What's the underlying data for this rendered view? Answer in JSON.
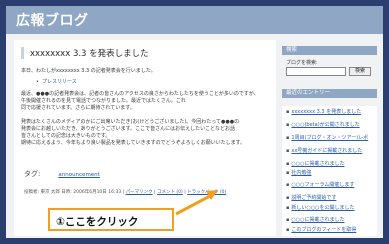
{
  "header": {
    "title": "広報ブログ"
  },
  "post": {
    "title": "xxxxxxxx 3.3 を発表しました",
    "intro": "本日、わたしがxxxxxxxx 3.3 の記者発表会を行いました。",
    "link": "プレスリリース",
    "body": [
      "最近、●●●の記者発表会は、記者の皆さんのアクセスの良さからわたしたちを使うことが多いのですが、",
      "午後開催されるのを見て電話でつながりました。最近ではたくさん。これ",
      "同で応援されています。さらに期待されています。",
      "発表はたくさんのメディアのかにご出席いただき(お(けどうございました)。今回わたって●●●の",
      "発表会にお越しいただき、ありがとうございます。ここで皆さんにはお伝えしたいことなどお話",
      "皆さんとしての記念は大きいものです。",
      "期待に応えるよう、今年もより良い製品を発表していきますのでどうぞよろしくお願いいたします。"
    ],
    "tag_label": "タグ:",
    "tag_value": "announcement",
    "footer_meta": "投稿者: 東京 太郎 日時: 2006年6月10日 16:33 |",
    "permalink": "パーマリンク",
    "comment_link": "コメント (0)",
    "trackback_link": "トラックバック (0)"
  },
  "callout": {
    "text": "①ここをクリック"
  },
  "sidebar": {
    "search_heading": "検索",
    "search_label": "ブログを検索:",
    "search_button": "検索",
    "entries_heading": "最近のエントリー",
    "entries": [
      "xxxxxxxx 3.3 を発表しました",
      "○○○(beta)が公開されました",
      "1周目(ブログ・オン・ツアー)レポ",
      "xx号機ガイドに掲載されました",
      "○○○に掲載されました",
      "社内勉強",
      "○○○フォーラム開催します",
      "説明ご予約開始です",
      "新しい○○○を公開しました",
      "○○○に掲載されました",
      "このブログのフィードを取得"
    ]
  },
  "colors": {
    "header": "#8fa6c4",
    "frame": "#2c3e6f",
    "callout_border": "#f0a020",
    "link": "#2a5db0"
  }
}
